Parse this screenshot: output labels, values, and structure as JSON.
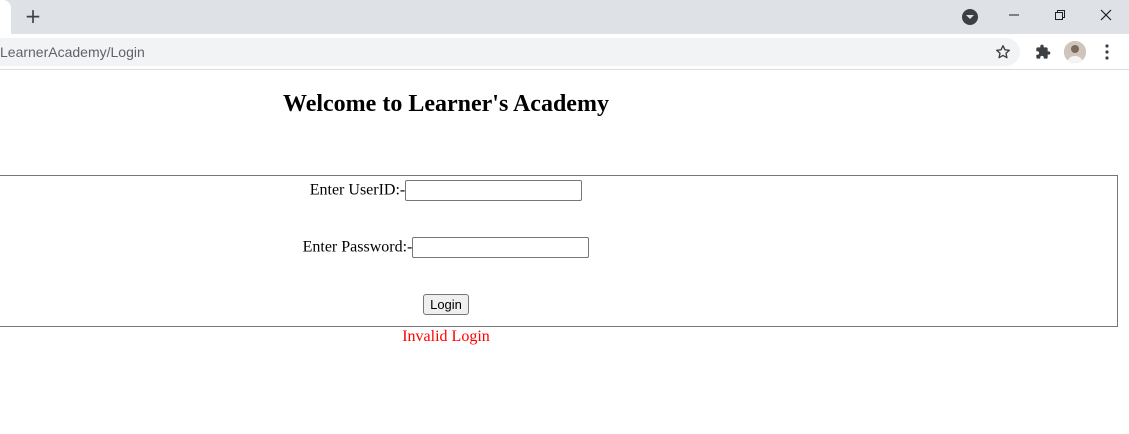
{
  "browser": {
    "url": "LearnerAcademy/Login",
    "new_tab_label": "+"
  },
  "page": {
    "heading": "Welcome to Learner's Academy",
    "form": {
      "userid_label": "Enter UserID:-",
      "userid_value": "",
      "password_label": "Enter Password:-",
      "password_value": "",
      "login_label": "Login"
    },
    "error_message": "Invalid Login",
    "error_color": "#ff0000"
  }
}
